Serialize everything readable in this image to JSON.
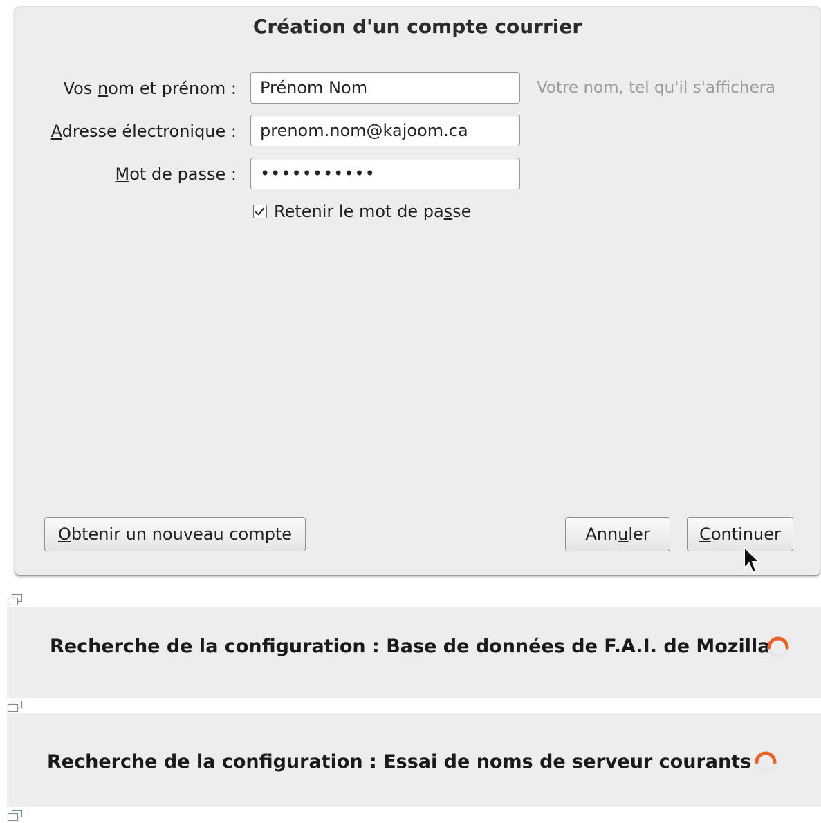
{
  "dialog": {
    "title": "Création d'un compte courrier",
    "fields": {
      "name": {
        "label_pre": "Vos ",
        "label_u": "n",
        "label_post": "om et prénom :",
        "value": "Prénom Nom",
        "hint": "Votre nom, tel qu'il s'affichera"
      },
      "email": {
        "label_pre": "",
        "label_u": "A",
        "label_post": "dresse électronique :",
        "value": "prenom.nom@kajoom.ca"
      },
      "password": {
        "label_pre": "",
        "label_u": "M",
        "label_post": "ot de passe :",
        "value": "•••••••••••"
      }
    },
    "remember": {
      "label_pre": "Retenir le mot de pa",
      "label_u": "s",
      "label_post": "se",
      "checked": true
    },
    "buttons": {
      "new_account": {
        "pre": "",
        "u": "O",
        "post": "btenir un nouveau compte"
      },
      "cancel": {
        "pre": "Ann",
        "u": "u",
        "post": "ler"
      },
      "continue": {
        "pre": "",
        "u": "C",
        "post": "ontinuer"
      }
    }
  },
  "status": [
    {
      "text": "Recherche de la configuration : Base de données de F.A.I. de Mozilla"
    },
    {
      "text": "Recherche de la configuration : Essai de noms de serveur courants"
    }
  ],
  "colors": {
    "dialog_bg": "#ededed",
    "spinner": "#e8622a"
  },
  "icons": [
    "restore-window-icon",
    "loading-spinner-icon",
    "mouse-pointer-icon",
    "checkmark-icon"
  ]
}
